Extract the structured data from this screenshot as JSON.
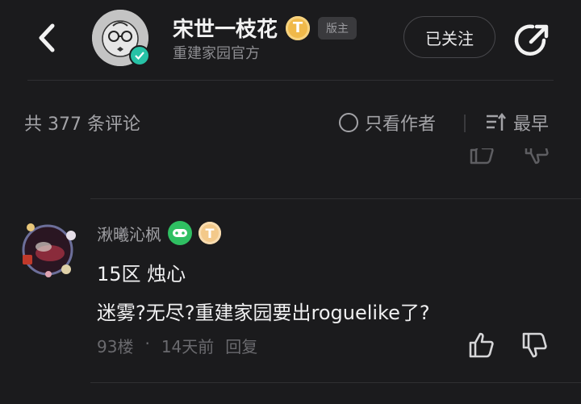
{
  "header": {
    "author_name": "宋世一枝花",
    "t_badge": "T",
    "owner_badge": "版主",
    "subtitle": "重建家园官方",
    "follow_label": "已关注"
  },
  "comments_bar": {
    "count_text": "共 377 条评论",
    "only_author_label": "只看作者",
    "sort_label": "最早"
  },
  "comment": {
    "username": "湫曦沁枫",
    "t_badge": "T",
    "line1": "15区 烛心",
    "line2": "迷雾?无尽?重建家园要出roguelike了?",
    "floor": "93楼",
    "dot": "·",
    "time": "14天前",
    "reply_label": "回复"
  },
  "colors": {
    "background": "#1b1b1d",
    "verify": "#27c2a6",
    "gold_badge": "#f0b94a",
    "game_badge": "#2fbf62"
  },
  "icons": {
    "back": "chevron-left-icon",
    "share": "share-icon",
    "like": "thumbs-up-icon",
    "dislike": "thumbs-down-icon",
    "sort": "sort-icon",
    "checkbox": "circle-icon"
  }
}
